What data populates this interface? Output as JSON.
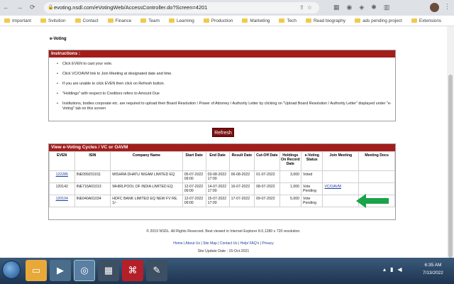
{
  "browser": {
    "url": "evoting.nsdl.com/eVotingWeb/AccessController.do?Screen=4201",
    "bookmarks": [
      "Important",
      "Svitution",
      "Contact",
      "Finance",
      "Team",
      "Learning",
      "Production",
      "Marketing",
      "Tech",
      "Read biography",
      "ads pending project",
      "Extensions"
    ]
  },
  "page": {
    "section_title": "e-Voting",
    "instructions_title": "Instructions :",
    "instructions": [
      "Click EVEN to cast your vote.",
      "Click VC/OAVM link to Join Meeting at designated date and time.",
      "If you are unable to click EVEN then click on Refresh button.",
      "\"Holdings\" with respect to Creditors refers to Amount Due",
      "Institutions, bodies corporate etc. are required to upload their Board Resolution / Power of Attorney / Authority Letter by clicking on \"Upload Board Resolution / Authority Letter\" displayed under \"e-Voting\" tab on this screen"
    ],
    "refresh_label": "Refresh",
    "cycles_title": "View e-Voting Cycles / VC or OAVM",
    "table": {
      "headers": [
        "EVEN",
        "ISIN",
        "Company Name",
        "Start Date",
        "End Date",
        "Result Date",
        "Cut-Off Date",
        "Holdings On Record Date",
        "e-Voting Status",
        "Join Meeting",
        "Meeting Docs"
      ],
      "rows": [
        [
          "122285",
          "INE099Z01011",
          "MISHRA DHATU NIGAM LIMITED EQ",
          "05-07-2022 09:00",
          "03-08-2022 17:00",
          "06-08-2022",
          "01-07-2022",
          "3,000",
          "Voted",
          "",
          ""
        ],
        [
          "120142",
          "INE716A01013",
          "WHIRLPOOL OF INDIA LIMITED EQ",
          "12-07-2022 09:00",
          "14-07-2022 17:00",
          "16-07-2022",
          "08-07-2022",
          "1,000",
          "Vote Pending",
          "VC/OAVM",
          ""
        ],
        [
          "120104",
          "INE040A01034",
          "HDFC BANK LIMITED EQ NEW FV RE. 1/-",
          "12-07-2022 09:00",
          "15-07-2022 17:00",
          "17-07-2022",
          "09-07-2022",
          "5,000",
          "Vote Pending",
          "",
          ""
        ]
      ]
    },
    "footer_copy": "© 2019 NSDL. All Rights Reserved. Best viewed in Internet Explorer 8.0,1280 x 720 resolution.",
    "footer_links": [
      "Home",
      "About Us",
      "Site Map",
      "Contact Us",
      "Help/ FAQ's",
      "Privacy"
    ],
    "footer_update": "Site Update Date : 15-Oct-2021"
  },
  "taskbar": {
    "time": "6:35 AM",
    "date": "7/13/2022"
  },
  "colors": {
    "header_red": "#a31d1d",
    "refresh_bg": "#7a1010",
    "arrow_green": "#1aa34a"
  }
}
